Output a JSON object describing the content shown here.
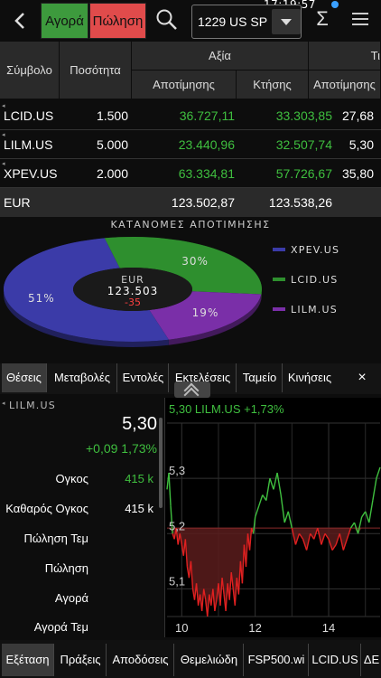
{
  "status": {
    "time": "17:19:57"
  },
  "toolbar": {
    "buy_label": "Αγορά",
    "sell_label": "Πώληση",
    "portfolio_value": "1229 US SP",
    "sigma": "Σ"
  },
  "holdings": {
    "headers": {
      "symbol": "Σύμβολο",
      "quantity": "Ποσότητα",
      "value_group": "Αξία",
      "price_group": "Τι",
      "valuation": "Αποτίμησης",
      "cost": "Κτήσης",
      "price_valuation": "Αποτίμησης"
    },
    "rows": [
      {
        "symbol": "LCID.US",
        "quantity": "1.500",
        "value": "36.727,11",
        "cost": "33.303,85",
        "price": "27,68"
      },
      {
        "symbol": "LILM.US",
        "quantity": "5.000",
        "value": "23.440,96",
        "cost": "32.507,74",
        "price": "5,30"
      },
      {
        "symbol": "XPEV.US",
        "quantity": "2.000",
        "value": "63.334,81",
        "cost": "57.726,67",
        "price": "35,80"
      }
    ],
    "total": {
      "currency": "EUR",
      "value": "123.502,87",
      "cost": "123.538,26"
    }
  },
  "allocation": {
    "title": "ΚΑΤΑΝΟΜΕΣ ΑΠΟΤΙΜΗΣΗΣ",
    "center_currency": "EUR",
    "center_total": "123.503",
    "center_change": "-35",
    "slices": [
      {
        "name": "XPEV.US",
        "percent": 51,
        "label": "51%",
        "color": "#3b3ba8"
      },
      {
        "name": "LCID.US",
        "percent": 30,
        "label": "30%",
        "color": "#2e8f2e"
      },
      {
        "name": "LILM.US",
        "percent": 19,
        "label": "19%",
        "color": "#7a2fa8"
      }
    ]
  },
  "tabs": [
    {
      "label": "Θέσεις",
      "active": true
    },
    {
      "label": "Μεταβολές",
      "active": false
    },
    {
      "label": "Εντολές",
      "active": false
    },
    {
      "label": "Εκτελέσεις",
      "active": false
    },
    {
      "label": "Ταμείο",
      "active": false
    },
    {
      "label": "Κινήσεις",
      "active": false
    }
  ],
  "tab_close": "×",
  "detail": {
    "symbol": "LILM.US",
    "price": "5,30",
    "change": "+0,09  1,73%",
    "rows": [
      {
        "label": "Ογκος",
        "value": "415 k",
        "color": "#3fbf3f"
      },
      {
        "label": "Καθαρός Ογκος",
        "value": "415 k",
        "color": "#ffffff"
      },
      {
        "label": "Πώληση Τεμ",
        "value": "",
        "color": "#ffffff"
      },
      {
        "label": "Πώληση",
        "value": "",
        "color": "#ffffff"
      },
      {
        "label": "Αγορά",
        "value": "",
        "color": "#ffffff"
      },
      {
        "label": "Αγορά Τεμ",
        "value": "",
        "color": "#ffffff"
      }
    ]
  },
  "chart_data": {
    "type": "line",
    "title": "5,30 LILM.US +1,73%",
    "reference_price": 5.21,
    "ylim": [
      5.05,
      5.4
    ],
    "xlim": [
      9.6,
      15.4
    ],
    "y_ticks": [
      {
        "value": 5.3,
        "label": "5,3"
      },
      {
        "value": 5.2,
        "label": "5,2"
      },
      {
        "value": 5.1,
        "label": "5,1"
      }
    ],
    "x_ticks": [
      {
        "value": 10,
        "label": "10"
      },
      {
        "value": 12,
        "label": "12"
      },
      {
        "value": 14,
        "label": "14"
      }
    ],
    "grid": true,
    "colors": {
      "above": "#3fbf3f",
      "below": "#e02020",
      "fill": "#5a1c1c"
    },
    "x": [
      9.6,
      9.65,
      9.7,
      9.75,
      9.8,
      9.85,
      9.9,
      9.95,
      10.0,
      10.05,
      10.1,
      10.15,
      10.2,
      10.25,
      10.3,
      10.35,
      10.4,
      10.45,
      10.5,
      10.55,
      10.6,
      10.65,
      10.7,
      10.75,
      10.8,
      10.85,
      10.9,
      10.95,
      11.0,
      11.05,
      11.1,
      11.15,
      11.2,
      11.25,
      11.3,
      11.35,
      11.4,
      11.45,
      11.5,
      11.55,
      11.6,
      11.65,
      11.7,
      11.75,
      11.8,
      11.85,
      11.9,
      11.95,
      12.0,
      12.1,
      12.2,
      12.3,
      12.4,
      12.5,
      12.6,
      12.7,
      12.8,
      12.9,
      13.0,
      13.1,
      13.2,
      13.3,
      13.4,
      13.5,
      13.6,
      13.7,
      13.8,
      13.9,
      14.0,
      14.1,
      14.2,
      14.3,
      14.4,
      14.5,
      14.6,
      14.7,
      14.8,
      14.9,
      15.0,
      15.1,
      15.2,
      15.3,
      15.4
    ],
    "values": [
      5.28,
      5.31,
      5.25,
      5.2,
      5.19,
      5.21,
      5.18,
      5.2,
      5.18,
      5.16,
      5.19,
      5.14,
      5.12,
      5.15,
      5.1,
      5.08,
      5.11,
      5.07,
      5.09,
      5.06,
      5.1,
      5.08,
      5.05,
      5.09,
      5.07,
      5.1,
      5.06,
      5.08,
      5.11,
      5.07,
      5.12,
      5.09,
      5.06,
      5.11,
      5.08,
      5.13,
      5.1,
      5.07,
      5.12,
      5.09,
      5.15,
      5.11,
      5.18,
      5.14,
      5.2,
      5.17,
      5.21,
      5.2,
      5.23,
      5.25,
      5.27,
      5.26,
      5.3,
      5.28,
      5.31,
      5.27,
      5.22,
      5.24,
      5.21,
      5.18,
      5.2,
      5.19,
      5.17,
      5.2,
      5.19,
      5.21,
      5.18,
      5.2,
      5.19,
      5.17,
      5.18,
      5.2,
      5.17,
      5.19,
      5.21,
      5.22,
      5.2,
      5.23,
      5.24,
      5.22,
      5.26,
      5.3,
      5.32
    ]
  },
  "bottom_tabs": [
    {
      "label": "Εξέταση",
      "active": true
    },
    {
      "label": "Πράξεις",
      "active": false
    },
    {
      "label": "Αποδόσεις",
      "active": false
    },
    {
      "label": "Θεμελιώδη",
      "active": false
    },
    {
      "label": "FSP500.wi",
      "active": false
    },
    {
      "label": "LCID.US",
      "active": false
    },
    {
      "label": "ΔΕ",
      "active": false
    }
  ]
}
